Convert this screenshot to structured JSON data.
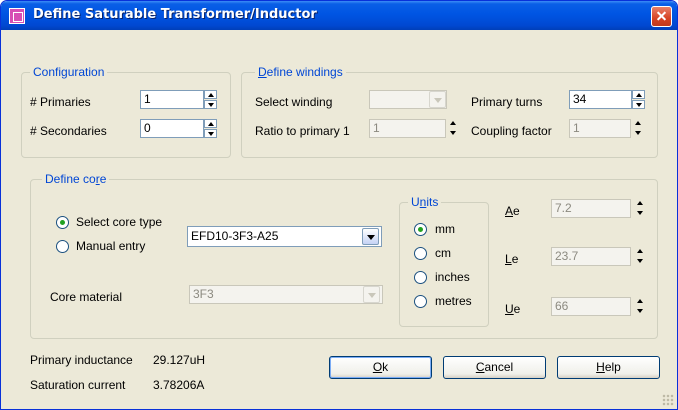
{
  "window": {
    "title": "Define Saturable Transformer/Inductor"
  },
  "configuration": {
    "group_title": "Configuration",
    "primaries_label": "# Primaries",
    "primaries_value": "1",
    "secondaries_label": "# Secondaries",
    "secondaries_value": "0"
  },
  "windings": {
    "group_title_mnemonic": "D",
    "group_title_rest": "efine windings",
    "select_winding_label": "Select winding",
    "select_winding_value": "",
    "ratio_label": "Ratio to primary 1",
    "ratio_value": "1",
    "primary_turns_label": "Primary turns",
    "primary_turns_value": "34",
    "coupling_label": "Coupling factor",
    "coupling_value": "1"
  },
  "core": {
    "group_title_pre": "Define co",
    "group_title_mnemonic": "r",
    "group_title_post": "e",
    "select_core_type_label": "Select core type",
    "manual_entry_label": "Manual entry",
    "selected_mode": "select_core_type",
    "core_type_value": "EFD10-3F3-A25",
    "core_material_label": "Core material",
    "core_material_value": "3F3",
    "units": {
      "group_title_pre": "U",
      "group_title_mnemonic": "n",
      "group_title_post": "its",
      "options": [
        "mm",
        "cm",
        "inches",
        "metres"
      ],
      "selected": "mm"
    },
    "ae_label_mnemonic": "A",
    "ae_label_rest": "e",
    "ae_value": "7.2",
    "le_label_mnemonic": "L",
    "le_label_rest": "e",
    "le_value": "23.7",
    "ue_label_mnemonic": "U",
    "ue_label_rest": "e",
    "ue_value": "66"
  },
  "results": {
    "primary_inductance_label": "Primary inductance",
    "primary_inductance_value": "29.127uH",
    "saturation_current_label": "Saturation current",
    "saturation_current_value": "3.78206A"
  },
  "buttons": {
    "ok_mnemonic": "O",
    "ok_rest": "k",
    "cancel_mnemonic": "C",
    "cancel_rest": "ancel",
    "help_mnemonic": "H",
    "help_rest": "elp"
  },
  "colors": {
    "titlebar": "#0055e3",
    "dialog_bg": "#ece9d8",
    "group_title": "#0046d5",
    "close_button": "#d64323",
    "radio_dot": "#21a121"
  }
}
